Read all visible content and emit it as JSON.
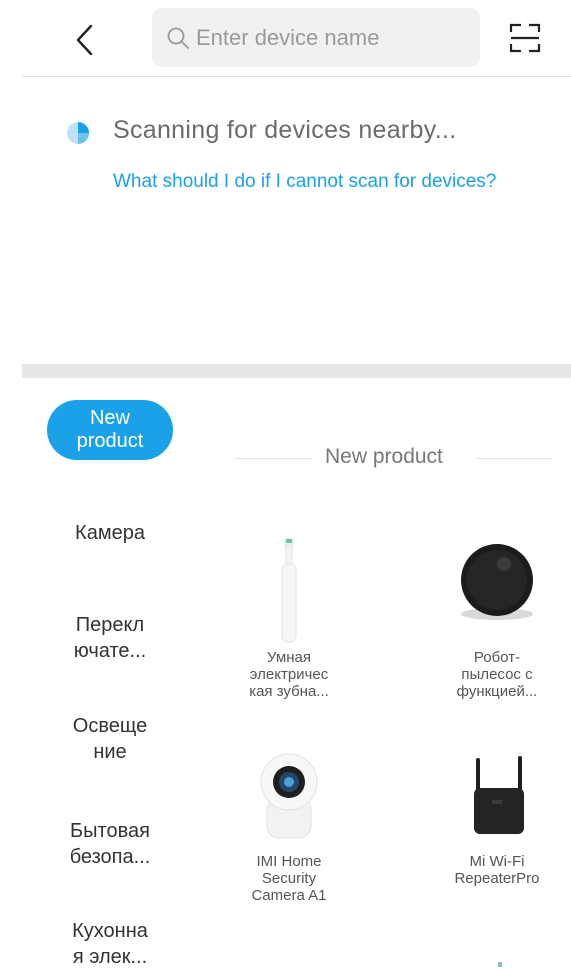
{
  "header": {
    "search_placeholder": "Enter device name"
  },
  "scan": {
    "status_text": "Scanning for devices nearby...",
    "help_link": "What should I do if I cannot scan for devices?"
  },
  "categories": {
    "selected": "New\nproduct",
    "items": [
      "Камера",
      "Перекл\nючате...",
      "Освеще\nние",
      "Бытовая\nбезопа...",
      "Кухонна\nя элек..."
    ]
  },
  "grid": {
    "title": "New product",
    "products": [
      {
        "name": "Умная\nэлектричес\nкая зубна...",
        "icon": "toothbrush-icon"
      },
      {
        "name": "Робот-\nпылесос с\nфункцией...",
        "icon": "robot-vacuum-icon"
      },
      {
        "name": "IMI Home\nSecurity\nCamera A1",
        "icon": "security-camera-icon"
      },
      {
        "name": "Mi Wi-Fi\nRepeaterPro",
        "icon": "wifi-repeater-icon"
      }
    ]
  },
  "colors": {
    "accent": "#1aa1e8",
    "divider": "#e7e7e7"
  }
}
